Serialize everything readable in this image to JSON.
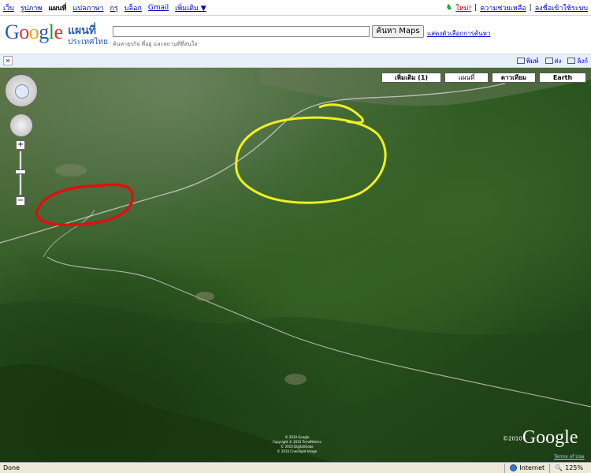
{
  "topnav": {
    "items": [
      "เว็บ",
      "รูปภาพ",
      "แผนที่",
      "แปลภาษา",
      "กรุ",
      "บล็อก",
      "Gmail",
      "เพิ่มเติม ▼"
    ],
    "current_index": 2,
    "new_label": "ใหม่!",
    "help_label": "ความช่วยเหลือ",
    "signin_label": "ลงชื่อเข้าใช้ระบบ"
  },
  "header": {
    "logo_text": "Google",
    "maps_title": "แผนที่",
    "maps_subtitle": "ประเทศไทย",
    "search_value": "",
    "search_button": "ค้นหา Maps",
    "search_options": "แสดงตัวเลือกการค้นหา",
    "search_hint": "ค้นหาธุรกิจ ที่อยู่ และสถานที่ที่สนใจ"
  },
  "toolbar": {
    "collapse": "»",
    "print_label": "พิมพ์",
    "send_label": "ส่ง",
    "link_label": "ลิงก์"
  },
  "map_types": {
    "more": "เพิ่มเติม (1)",
    "map": "แผนที่",
    "satellite": "ดาวเทียม",
    "earth": "Earth"
  },
  "map": {
    "copyright_lines": [
      "© 2010 Google",
      "Copyright © 2010 TerraMetrics",
      "© 2010 DigitalGlobe",
      "© 2010 Cnes/Spot Image"
    ],
    "logo_year": "©2010",
    "logo_text": "Google",
    "terms_label": "Terms of Use",
    "annotation_colors": {
      "red": "#e01010",
      "yellow": "#f0f020"
    }
  },
  "zoom": {
    "plus": "+",
    "minus": "−"
  },
  "status": {
    "done": "Done",
    "zone": "Internet",
    "zoom": "125%"
  }
}
